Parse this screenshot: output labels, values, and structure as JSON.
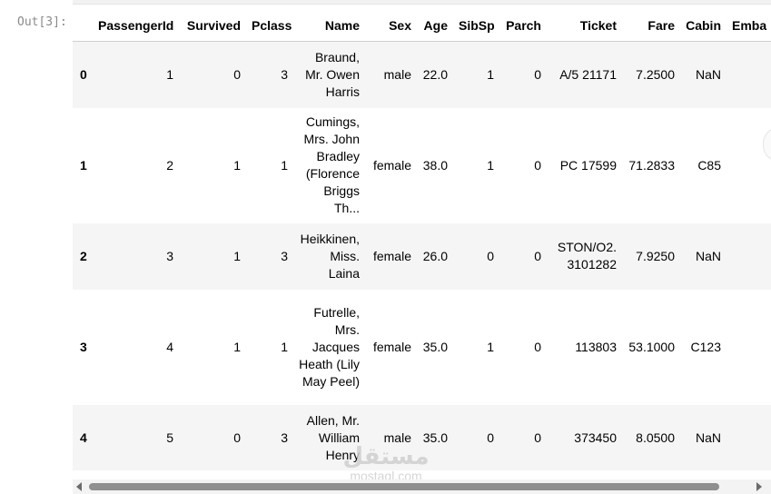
{
  "prompt": "Out[3]:",
  "table": {
    "columns": [
      "",
      "PassengerId",
      "Survived",
      "Pclass",
      "Name",
      "Sex",
      "Age",
      "SibSp",
      "Parch",
      "Ticket",
      "Fare",
      "Cabin",
      "Emba"
    ],
    "rows": [
      {
        "index": "0",
        "PassengerId": "1",
        "Survived": "0",
        "Pclass": "3",
        "Name": "Braund, Mr. Owen Harris",
        "Sex": "male",
        "Age": "22.0",
        "SibSp": "1",
        "Parch": "0",
        "Ticket": "A/5 21171",
        "Fare": "7.2500",
        "Cabin": "NaN",
        "Embarked": ""
      },
      {
        "index": "1",
        "PassengerId": "2",
        "Survived": "1",
        "Pclass": "1",
        "Name": "Cumings, Mrs. John Bradley (Florence Briggs Th...",
        "Sex": "female",
        "Age": "38.0",
        "SibSp": "1",
        "Parch": "0",
        "Ticket": "PC 17599",
        "Fare": "71.2833",
        "Cabin": "C85",
        "Embarked": ""
      },
      {
        "index": "2",
        "PassengerId": "3",
        "Survived": "1",
        "Pclass": "3",
        "Name": "Heikkinen, Miss. Laina",
        "Sex": "female",
        "Age": "26.0",
        "SibSp": "0",
        "Parch": "0",
        "Ticket": "STON/O2. 3101282",
        "Fare": "7.9250",
        "Cabin": "NaN",
        "Embarked": ""
      },
      {
        "index": "3",
        "PassengerId": "4",
        "Survived": "1",
        "Pclass": "1",
        "Name": "Futrelle, Mrs. Jacques Heath (Lily May Peel)",
        "Sex": "female",
        "Age": "35.0",
        "SibSp": "1",
        "Parch": "0",
        "Ticket": "113803",
        "Fare": "53.1000",
        "Cabin": "C123",
        "Embarked": ""
      },
      {
        "index": "4",
        "PassengerId": "5",
        "Survived": "0",
        "Pclass": "3",
        "Name": "Allen, Mr. William Henry",
        "Sex": "male",
        "Age": "35.0",
        "SibSp": "0",
        "Parch": "0",
        "Ticket": "373450",
        "Fare": "8.0500",
        "Cabin": "NaN",
        "Embarked": ""
      }
    ]
  },
  "watermark": {
    "arabic": "مستقل",
    "latin": "mostaql.com"
  }
}
